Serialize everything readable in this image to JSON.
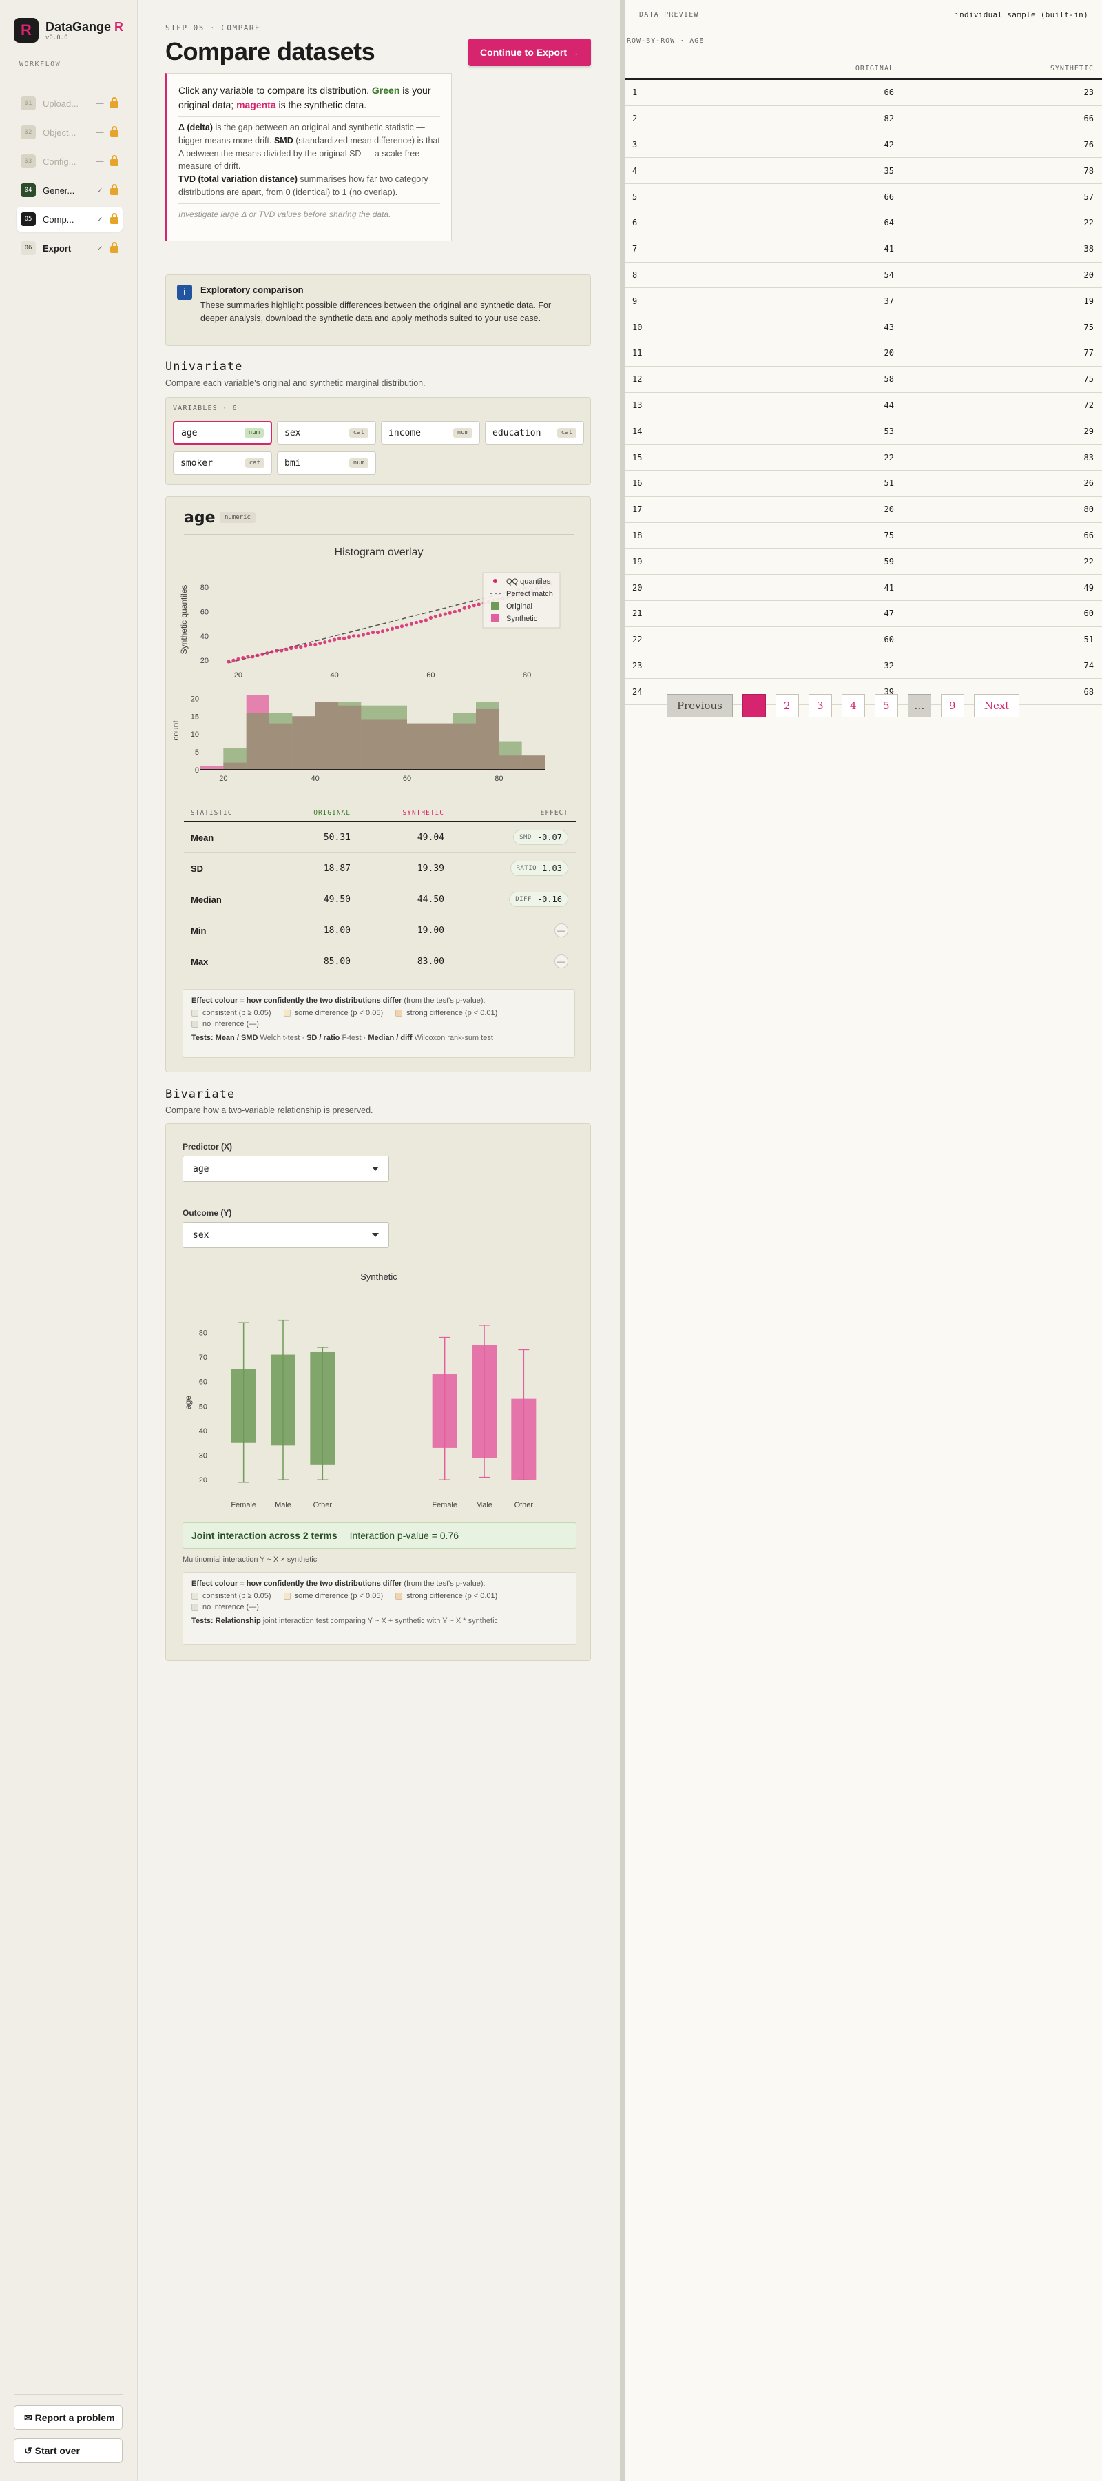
{
  "app": {
    "name": "DataGange",
    "name_accent": "R",
    "version": "v0.0.0"
  },
  "sidebar": {
    "label": "WORKFLOW",
    "steps": [
      {
        "num": "01",
        "label": "Upload...",
        "state": "disabled",
        "check": "—"
      },
      {
        "num": "02",
        "label": "Object...",
        "state": "disabled",
        "check": "—"
      },
      {
        "num": "03",
        "label": "Config...",
        "state": "disabled",
        "check": "—"
      },
      {
        "num": "04",
        "label": "Gener...",
        "state": "done",
        "check": "✓"
      },
      {
        "num": "05",
        "label": "Comp...",
        "state": "active",
        "check": "✓"
      },
      {
        "num": "06",
        "label": "Export",
        "state": "next",
        "check": "✓"
      }
    ],
    "report_label": "✉ Report a problem",
    "restart_label": "↺ Start over"
  },
  "header": {
    "eyebrow": "STEP 05 · COMPARE",
    "title": "Compare datasets",
    "cta": "Continue to Export →"
  },
  "intro": {
    "lead_1": "Click any variable to compare its distribution. ",
    "green": "Green",
    "lead_2": " is your original data; ",
    "magenta": "magenta",
    "lead_3": " is the synthetic data.",
    "delta_term": "Δ (delta)",
    "delta_text": " is the gap between an original and synthetic statistic — bigger means more drift. ",
    "smd_term": "SMD",
    "smd_text": " (standardized mean difference) is that Δ between the means divided by the original SD — a scale-free measure of drift.",
    "tvd_term": "TVD (total variation distance)",
    "tvd_text": " summarises how far two category distributions are apart, from 0 (identical) to 1 (no overlap).",
    "note": "Investigate large Δ or TVD values before sharing the data."
  },
  "exploratory": {
    "icon": "i",
    "title": "Exploratory comparison",
    "body": "These summaries highlight possible differences between the original and synthetic data. For deeper analysis, download the synthetic data and apply methods suited to your use case."
  },
  "univariate": {
    "title": "Univariate",
    "subtitle": "Compare each variable's original and synthetic marginal distribution.",
    "variables_label": "VARIABLES · 6",
    "variables": [
      {
        "name": "age",
        "type": "num"
      },
      {
        "name": "sex",
        "type": "cat"
      },
      {
        "name": "income",
        "type": "num"
      },
      {
        "name": "education",
        "type": "cat"
      },
      {
        "name": "smoker",
        "type": "cat"
      },
      {
        "name": "bmi",
        "type": "num"
      }
    ],
    "selected": {
      "name": "age",
      "type_label": "numeric"
    },
    "chart_title": "Histogram overlay",
    "stats_head": [
      "STATISTIC",
      "ORIGINAL",
      "SYNTHETIC",
      "EFFECT"
    ],
    "stats": [
      {
        "name": "Mean",
        "original": "50.31",
        "synthetic": "49.04",
        "effect_key": "SMD",
        "effect_val": "-0.07"
      },
      {
        "name": "SD",
        "original": "18.87",
        "synthetic": "19.39",
        "effect_key": "RATIO",
        "effect_val": "1.03"
      },
      {
        "name": "Median",
        "original": "49.50",
        "synthetic": "44.50",
        "effect_key": "DIFF",
        "effect_val": "-0.16"
      },
      {
        "name": "Min",
        "original": "18.00",
        "synthetic": "19.00",
        "effect_key": "",
        "effect_val": "—"
      },
      {
        "name": "Max",
        "original": "85.00",
        "synthetic": "83.00",
        "effect_key": "",
        "effect_val": "—"
      }
    ],
    "legend": {
      "title_bold": "Effect colour = how confidently the two distributions differ",
      "title_rest": " (from the test's p-value):",
      "items": [
        {
          "label": "consistent (p ≥ 0.05)",
          "color": "#e9e6dc"
        },
        {
          "label": "some difference (p < 0.05)",
          "color": "#f7e7c4"
        },
        {
          "label": "strong difference (p < 0.01)",
          "color": "#f5d3a8"
        },
        {
          "label": "no inference (—)",
          "color": "#e2e0d8"
        }
      ],
      "tests_label": "Tests:",
      "tests_1b": "Mean / SMD",
      "tests_1": " Welch t-test · ",
      "tests_2b": "SD / ratio",
      "tests_2": " F-test · ",
      "tests_3b": "Median / diff",
      "tests_3": " Wilcoxon rank-sum test"
    }
  },
  "bivariate": {
    "title": "Bivariate",
    "subtitle": "Compare how a two-variable relationship is preserved.",
    "predictor_label": "Predictor (X)",
    "predictor_value": "age",
    "outcome_label": "Outcome (Y)",
    "outcome_value": "sex",
    "chart_title": "Synthetic",
    "result_title": "Joint interaction across 2 terms",
    "result_value": "Interaction p-value = 0.76",
    "model_note": "Multinomial interaction Y ~ X × synthetic",
    "legend": {
      "title_bold": "Effect colour = how confidently the two distributions differ",
      "title_rest": " (from the test's p-value):",
      "items": [
        {
          "label": "consistent (p ≥ 0.05)",
          "color": "#e9e6dc"
        },
        {
          "label": "some difference (p < 0.05)",
          "color": "#f7e7c4"
        },
        {
          "label": "strong difference (p < 0.01)",
          "color": "#f5d3a8"
        },
        {
          "label": "no inference (—)",
          "color": "#e2e0d8"
        }
      ],
      "tests_label": "Tests:",
      "tests_1b": "Relationship",
      "tests_1": " joint interaction test comparing Y ~ X + synthetic with Y ~ X * synthetic"
    }
  },
  "preview": {
    "label": "DATA PREVIEW",
    "dataset": "individual_sample (built-in)",
    "sub": "ROW-BY-ROW · AGE",
    "columns": [
      "ORIGINAL",
      "SYNTHETIC"
    ],
    "rows": [
      [
        1,
        66,
        23
      ],
      [
        2,
        82,
        66
      ],
      [
        3,
        42,
        76
      ],
      [
        4,
        35,
        78
      ],
      [
        5,
        66,
        57
      ],
      [
        6,
        64,
        22
      ],
      [
        7,
        41,
        38
      ],
      [
        8,
        54,
        20
      ],
      [
        9,
        37,
        19
      ],
      [
        10,
        43,
        75
      ],
      [
        11,
        20,
        77
      ],
      [
        12,
        58,
        75
      ],
      [
        13,
        44,
        72
      ],
      [
        14,
        53,
        29
      ],
      [
        15,
        22,
        83
      ],
      [
        16,
        51,
        26
      ],
      [
        17,
        20,
        80
      ],
      [
        18,
        75,
        66
      ],
      [
        19,
        59,
        22
      ],
      [
        20,
        41,
        49
      ],
      [
        21,
        47,
        60
      ],
      [
        22,
        60,
        51
      ],
      [
        23,
        32,
        74
      ],
      [
        24,
        39,
        68
      ]
    ],
    "pager": {
      "prev": "Previous",
      "pages": [
        "1",
        "2",
        "3",
        "4",
        "5",
        "…",
        "9"
      ],
      "current": "1",
      "next": "Next"
    }
  },
  "colors": {
    "original": "#6f9a58",
    "synthetic": "#e35fa0",
    "accent": "#d6246e"
  },
  "chart_data": [
    {
      "type": "scatter",
      "title": "",
      "ylabel": "Synthetic quantiles",
      "xlim": [
        15,
        88
      ],
      "ylim": [
        15,
        92
      ],
      "xticks": [
        20,
        40,
        60,
        80
      ],
      "yticks": [
        20,
        40,
        60,
        80
      ],
      "legend": [
        "QQ quantiles",
        "Perfect match",
        "Original",
        "Synthetic"
      ],
      "legend_position": "top-right",
      "points": [
        [
          18,
          19
        ],
        [
          19,
          20
        ],
        [
          20,
          21
        ],
        [
          21,
          22
        ],
        [
          22,
          23
        ],
        [
          23,
          23
        ],
        [
          24,
          24
        ],
        [
          25,
          25
        ],
        [
          26,
          26
        ],
        [
          27,
          27
        ],
        [
          28,
          28
        ],
        [
          29,
          28
        ],
        [
          30,
          29
        ],
        [
          31,
          30
        ],
        [
          32,
          31
        ],
        [
          33,
          31
        ],
        [
          34,
          32
        ],
        [
          35,
          33
        ],
        [
          36,
          33
        ],
        [
          37,
          34
        ],
        [
          38,
          35
        ],
        [
          39,
          36
        ],
        [
          40,
          37
        ],
        [
          41,
          38
        ],
        [
          42,
          38
        ],
        [
          43,
          39
        ],
        [
          44,
          40
        ],
        [
          45,
          40
        ],
        [
          46,
          41
        ],
        [
          47,
          42
        ],
        [
          48,
          43
        ],
        [
          49,
          43
        ],
        [
          50,
          44
        ],
        [
          51,
          45
        ],
        [
          52,
          46
        ],
        [
          53,
          47
        ],
        [
          54,
          48
        ],
        [
          55,
          49
        ],
        [
          56,
          50
        ],
        [
          57,
          51
        ],
        [
          58,
          52
        ],
        [
          59,
          53
        ],
        [
          60,
          55
        ],
        [
          61,
          56
        ],
        [
          62,
          57
        ],
        [
          63,
          58
        ],
        [
          64,
          59
        ],
        [
          65,
          60
        ],
        [
          66,
          61
        ],
        [
          67,
          63
        ],
        [
          68,
          64
        ],
        [
          69,
          65
        ],
        [
          70,
          66
        ],
        [
          71,
          67
        ],
        [
          72,
          68
        ],
        [
          73,
          69
        ],
        [
          74,
          70
        ],
        [
          75,
          71
        ],
        [
          76,
          72
        ],
        [
          77,
          73
        ],
        [
          78,
          74
        ],
        [
          79,
          75
        ],
        [
          80,
          76
        ],
        [
          81,
          77
        ],
        [
          82,
          79
        ],
        [
          83,
          80
        ],
        [
          84,
          82
        ],
        [
          85,
          83
        ]
      ],
      "reference_line": [
        [
          18,
          18
        ],
        [
          85,
          85
        ]
      ]
    },
    {
      "type": "bar",
      "title": "Histogram overlay",
      "xlabel": "",
      "ylabel": "count",
      "xlim": [
        15,
        90
      ],
      "ylim": [
        0,
        22
      ],
      "xticks": [
        20,
        40,
        60,
        80
      ],
      "yticks": [
        0,
        5,
        10,
        15,
        20
      ],
      "bins": [
        [
          15,
          20
        ],
        [
          20,
          25
        ],
        [
          25,
          30
        ],
        [
          30,
          35
        ],
        [
          35,
          40
        ],
        [
          40,
          45
        ],
        [
          45,
          50
        ],
        [
          50,
          55
        ],
        [
          55,
          60
        ],
        [
          60,
          65
        ],
        [
          65,
          70
        ],
        [
          70,
          75
        ],
        [
          75,
          80
        ],
        [
          80,
          85
        ],
        [
          85,
          90
        ]
      ],
      "series": [
        {
          "name": "Original",
          "values": [
            0,
            6,
            16,
            16,
            15,
            19,
            19,
            18,
            18,
            13,
            13,
            16,
            19,
            8,
            4
          ]
        },
        {
          "name": "Synthetic",
          "values": [
            1,
            2,
            21,
            13,
            15,
            19,
            18,
            14,
            14,
            13,
            13,
            13,
            17,
            4,
            4
          ]
        }
      ]
    },
    {
      "type": "box",
      "title": "Synthetic",
      "xlabel": "sex",
      "ylabel": "age",
      "ylim": [
        15,
        88
      ],
      "yticks": [
        20,
        30,
        40,
        50,
        60,
        70,
        80
      ],
      "panels": [
        {
          "name": "Original",
          "categories": [
            "Female",
            "Male",
            "Other"
          ],
          "q1": [
            35,
            34,
            26
          ],
          "q3": [
            65,
            71,
            72
          ],
          "whisker_low": [
            19,
            20,
            20
          ],
          "whisker_high": [
            84,
            85,
            74
          ]
        },
        {
          "name": "Synthetic",
          "categories": [
            "Female",
            "Male",
            "Other"
          ],
          "q1": [
            33,
            29,
            20
          ],
          "q3": [
            63,
            75,
            53
          ],
          "whisker_low": [
            20,
            21,
            20
          ],
          "whisker_high": [
            78,
            83,
            73
          ]
        }
      ]
    }
  ]
}
